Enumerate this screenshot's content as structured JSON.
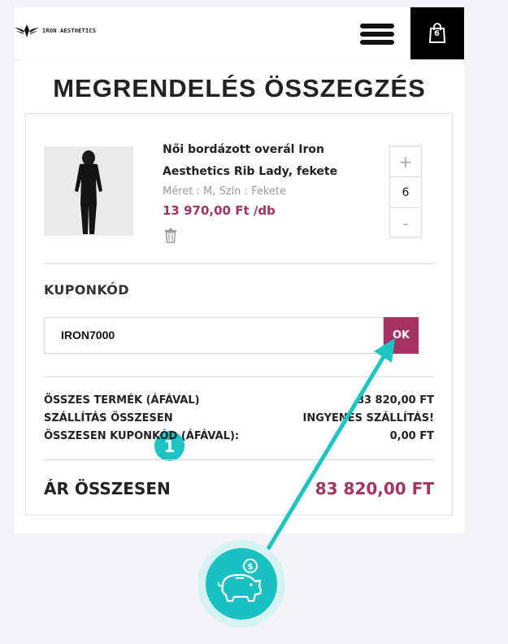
{
  "brand": {
    "logo_text": "IRON AESTHETICS"
  },
  "header": {
    "cart_count": "6"
  },
  "page": {
    "title": "MEGRENDELÉS ÖSSZEGZÉS"
  },
  "product": {
    "name": "Női bordázott overál Iron Aesthetics Rib Lady, fekete",
    "meta": "Méret : M, Szín : Fekete",
    "price": "13 970,00 Ft /db",
    "quantity": "6",
    "plus": "+",
    "minus": "-"
  },
  "coupon": {
    "label": "KUPONKÓD",
    "value": "IRON7000",
    "ok_label": "OK"
  },
  "summary": {
    "rows": [
      {
        "label": "ÖSSZES TERMÉK (ÁFÁVAL)",
        "value": "83 820,00 FT"
      },
      {
        "label": "SZÁLLÍTÁS ÖSSZESEN",
        "value": "INGYENES SZÁLLÍTÁS!"
      },
      {
        "label": "ÖSSZESEN KUPONKÓD (ÁFÁVAL):",
        "value": "0,00 FT"
      }
    ],
    "total_label": "ÁR ÖSSZESEN",
    "total_value": "83 820,00 FT"
  },
  "annotation": {
    "step": "1"
  },
  "colors": {
    "accent": "#a4345f",
    "teal": "#1dc4c4",
    "black": "#000000"
  },
  "icons": [
    "hamburger-menu-icon",
    "shopping-bag-icon",
    "trash-icon",
    "piggy-bank-icon",
    "arrow"
  ]
}
